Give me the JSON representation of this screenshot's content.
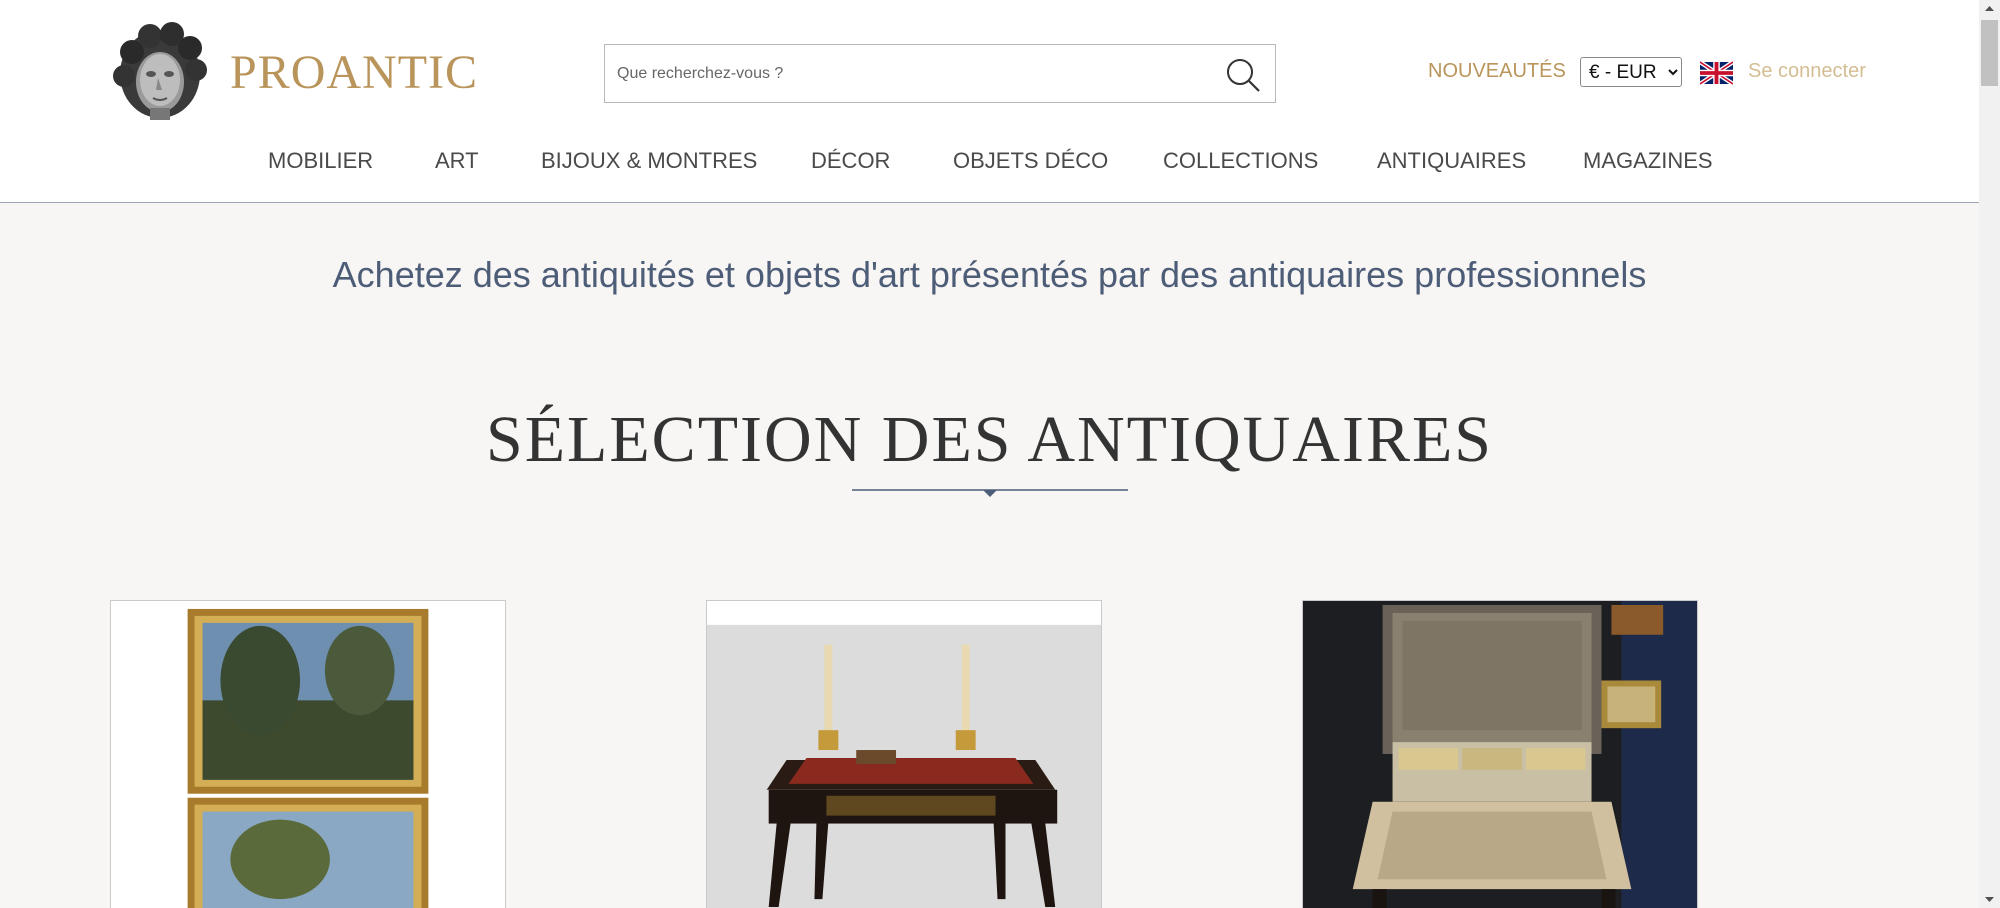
{
  "header": {
    "logo_text": "PROANTIC",
    "search_placeholder": "Que recherchez-vous ?",
    "nouveautes": "NOUVEAUTÉS",
    "currency": "€ - EUR",
    "login": "Se connecter"
  },
  "nav": {
    "items": [
      {
        "label": "MOBILIER"
      },
      {
        "label": "ART"
      },
      {
        "label": "BIJOUX & MONTRES"
      },
      {
        "label": "DÉCOR"
      },
      {
        "label": "OBJETS DÉCO"
      },
      {
        "label": "COLLECTIONS"
      },
      {
        "label": "ANTIQUAIRES"
      },
      {
        "label": "MAGAZINES"
      }
    ]
  },
  "main": {
    "tagline": "Achetez des antiquités et objets d'art présentés par des antiquaires professionnels",
    "section_title": "SÉLECTION DES ANTIQUAIRES"
  },
  "icons": {
    "search": "search-icon",
    "flag": "uk-flag-icon",
    "logo": "sculpted-head-logo-icon"
  },
  "colors": {
    "brand_gold": "#b9955b",
    "login_gold": "#d3bd93",
    "tagline_blue": "#4d5d78",
    "background": "#f7f6f4"
  }
}
